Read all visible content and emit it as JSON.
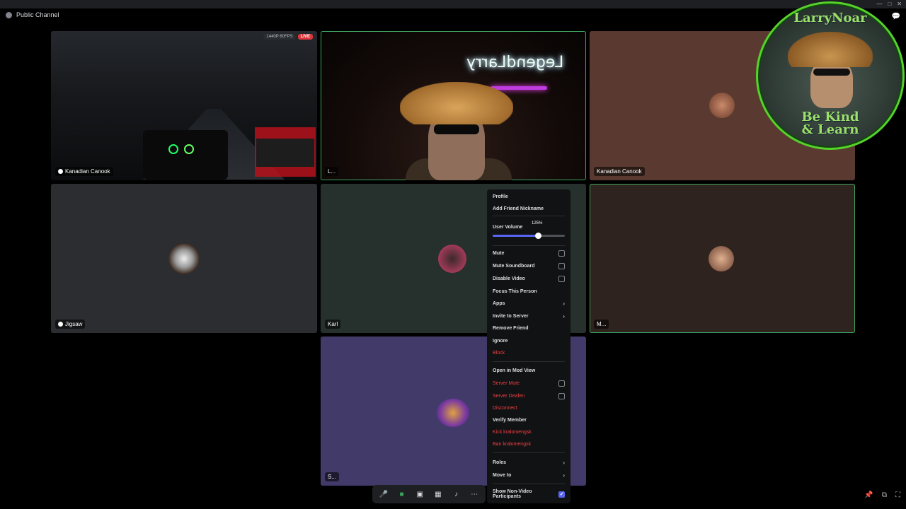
{
  "window": {
    "title": "Public Channel"
  },
  "tiles": [
    {
      "id": "t1",
      "name": "Kanadian Canook",
      "badge_res": "1440P 60FPS",
      "badge_live": "LIVE"
    },
    {
      "id": "t2",
      "name": "L...",
      "neon_text": "LegendLarry"
    },
    {
      "id": "t3",
      "name": "Kanadian Canook"
    },
    {
      "id": "t4",
      "name": "Jigsaw"
    },
    {
      "id": "t5",
      "name": "Karl"
    },
    {
      "id": "t6",
      "name": "M..."
    },
    {
      "id": "t7",
      "name": "S..."
    }
  ],
  "logo": {
    "top_text": "LarryNoar",
    "bottom_line1": "Be Kind",
    "bottom_line2": "& Learn"
  },
  "context_menu": {
    "profile": "Profile",
    "add_friend_nickname": "Add Friend Nickname",
    "user_volume": "User Volume",
    "volume_value": "125%",
    "volume_fraction": 0.625,
    "mute": "Mute",
    "mute_soundboard": "Mute Soundboard",
    "disable_video": "Disable Video",
    "focus_this_person": "Focus This Person",
    "apps": "Apps",
    "invite_to_server": "Invite to Server",
    "remove_friend": "Remove Friend",
    "ignore": "Ignore",
    "block": "Block",
    "open_in_mod_view": "Open in Mod View",
    "server_mute": "Server Mute",
    "server_deafen": "Server Deafen",
    "disconnect": "Disconnect",
    "verify_member": "Verify Member",
    "kick": "Kick kralomengsk",
    "ban": "Ban kralomengsk",
    "roles": "Roles",
    "move_to": "Move to",
    "show_non_video": "Show Non-Video Participants"
  },
  "colors": {
    "accent": "#5865f2",
    "danger": "#f23f43",
    "speaking": "#3ba55d",
    "menu_bg": "#111214"
  },
  "icons": [
    "microphone-icon",
    "camera-icon",
    "screen-share-icon",
    "activities-icon",
    "soundboard-icon",
    "more-icon",
    "pin-icon",
    "popout-icon",
    "fullscreen-icon",
    "chat-icon"
  ]
}
